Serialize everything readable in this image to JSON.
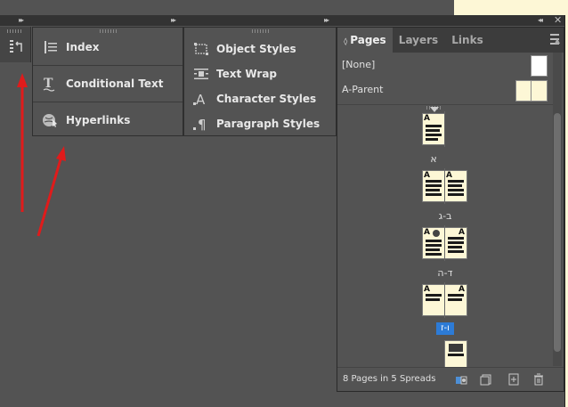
{
  "left_panel": {
    "items": [
      {
        "label": "Index",
        "icon": "index-icon"
      },
      {
        "label": "Conditional Text",
        "icon": "conditional-text-icon"
      },
      {
        "label": "Hyperlinks",
        "icon": "hyperlinks-icon"
      }
    ]
  },
  "styles_panel": {
    "items": [
      {
        "label": "Object Styles",
        "icon": "object-styles-icon"
      },
      {
        "label": "Text Wrap",
        "icon": "text-wrap-icon"
      },
      {
        "label": "Character Styles",
        "icon": "character-styles-icon"
      },
      {
        "label": "Paragraph Styles",
        "icon": "paragraph-styles-icon"
      }
    ]
  },
  "pages_panel": {
    "tabs": [
      {
        "label": "Pages",
        "active": true
      },
      {
        "label": "Layers",
        "active": false
      },
      {
        "label": "Links",
        "active": false
      }
    ],
    "masters": [
      {
        "label": "[None]"
      },
      {
        "label": "A-Parent"
      }
    ],
    "page_thumb_letter": "A",
    "spreads": [
      {
        "label": "א",
        "selected": false
      },
      {
        "label": "ב-ג",
        "selected": false
      },
      {
        "label": "ד-ה",
        "selected": false
      },
      {
        "label": "ו-ז",
        "selected": true
      }
    ],
    "status": "8 Pages in 5 Spreads"
  },
  "colors": {
    "accent": "#2d7bd6",
    "arrow": "#e01b1b",
    "page_paper": "#fdf7d6"
  }
}
